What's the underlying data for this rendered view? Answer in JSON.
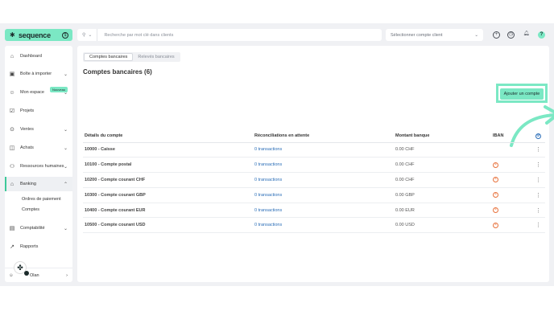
{
  "app": {
    "logo_text": "sequence",
    "logo_badge": "$",
    "brand_color": "#7be8c4"
  },
  "topbar": {
    "search_placeholder": "Recherche par mot clé dans clients",
    "client_select": "Sélectionner compte client",
    "icons": [
      "plus-icon",
      "clock-icon",
      "bell-icon",
      "help-icon"
    ]
  },
  "sidebar": {
    "items": [
      {
        "label": "Dashboard",
        "icon": "home-icon",
        "chevron": false
      },
      {
        "label": "Boîte à importer",
        "icon": "inbox-icon",
        "chevron": true,
        "badge": "Nouveau"
      },
      {
        "label": "Mon espace",
        "icon": "user-icon",
        "chevron": true
      },
      {
        "label": "Projets",
        "icon": "check-square-icon",
        "chevron": false
      },
      {
        "label": "Ventes",
        "icon": "sales-icon",
        "chevron": true
      },
      {
        "label": "Achats",
        "icon": "bag-icon",
        "chevron": true
      },
      {
        "label": "Ressources humaines",
        "icon": "people-icon",
        "chevron": true
      },
      {
        "label": "Banking",
        "icon": "bank-icon",
        "chevron": true,
        "active": true
      },
      {
        "label": "Comptabilité",
        "icon": "ledger-icon",
        "chevron": true
      },
      {
        "label": "Rapports",
        "icon": "chart-icon",
        "chevron": false
      }
    ],
    "sub_items": [
      "Ordres de paiement",
      "Comptes"
    ],
    "user_name": "Olan"
  },
  "main": {
    "tabs": [
      "Comptes bancaires",
      "Relevés bancaires"
    ],
    "title": "Comptes bancaires (6)",
    "add_button": "Ajouter un compte",
    "columns": [
      "Détails du compte",
      "Réconciliations en attente",
      "Montant banque",
      "IBAN"
    ],
    "rows": [
      {
        "name": "10000 - Caisse",
        "pending": "0 transactions",
        "amount": "0.00 CHF",
        "iban_missing": false
      },
      {
        "name": "10100 - Compte postal",
        "pending": "0 transactions",
        "amount": "0.00 CHF",
        "iban_missing": true
      },
      {
        "name": "10200 - Compte courant CHF",
        "pending": "0 transactions",
        "amount": "0.00 CHF",
        "iban_missing": true
      },
      {
        "name": "10300 - Compte courant GBP",
        "pending": "0 transactions",
        "amount": "0.00 GBP",
        "iban_missing": true
      },
      {
        "name": "10400 - Compte courant EUR",
        "pending": "0 transactions",
        "amount": "0.00 EUR",
        "iban_missing": true
      },
      {
        "name": "10500 - Compte courant USD",
        "pending": "0 transactions",
        "amount": "0.00 USD",
        "iban_missing": true
      }
    ]
  }
}
